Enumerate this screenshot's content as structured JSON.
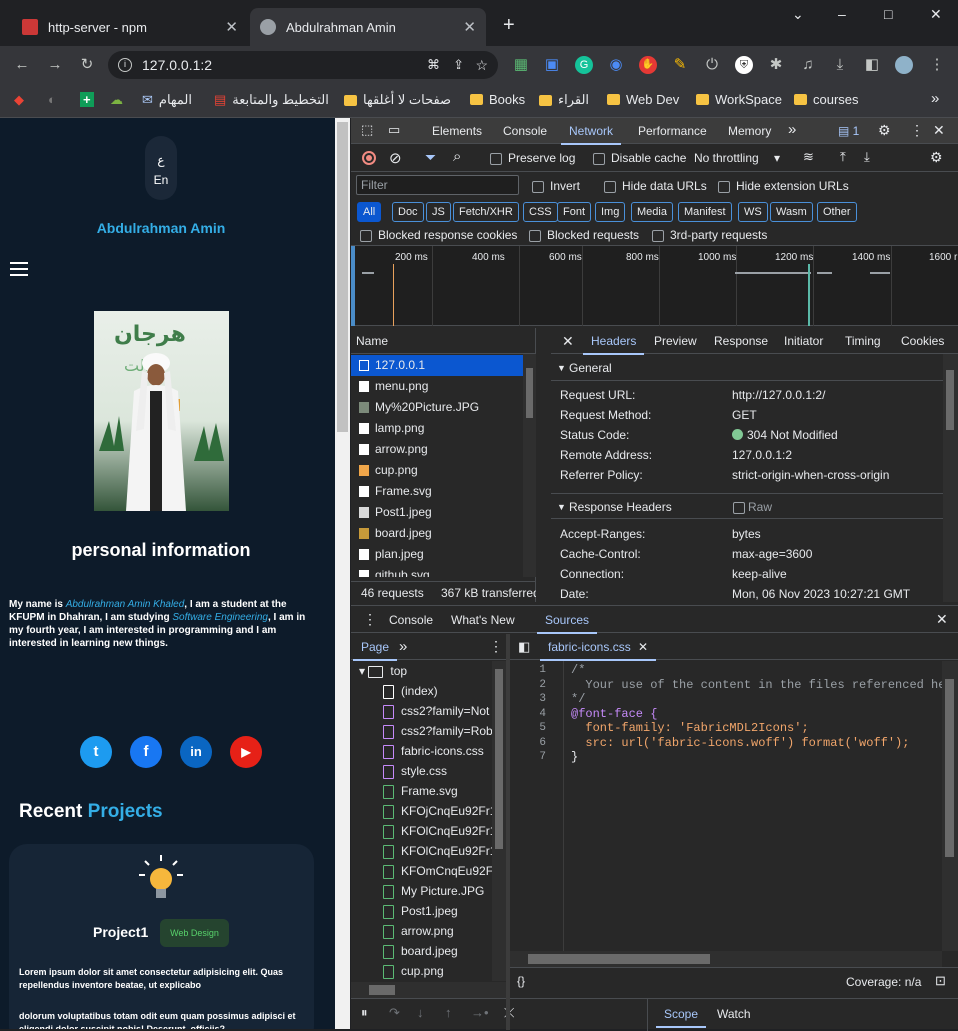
{
  "tabs": [
    {
      "title": "http-server - npm",
      "active": false
    },
    {
      "title": "Abdulrahman Amin",
      "active": true
    }
  ],
  "window": {
    "new_tab": "+",
    "minimize": "–",
    "maximize": "□",
    "close": "✕",
    "chevron": "⌄"
  },
  "omnibox": {
    "url": "127.0.0.1:2"
  },
  "bookmarks": [
    "المهام",
    "التخطيط والمتابعة",
    "صفحات لا أغلقها",
    "Books",
    "القراء",
    "Web Dev",
    "WorkSpace",
    "courses"
  ],
  "bookmarks_more": "»",
  "page": {
    "lang_ar": "ع",
    "lang_en": "En",
    "name": "Abdulrahman Amin",
    "personal_title": "personal information",
    "intro_pre": "My name is ",
    "intro_name": "Abdulrahman Amin Khaled",
    "intro_mid": ", I am a student at the KFUPM in Dhahran, I am studying ",
    "intro_major": "Software Engineering",
    "intro_post": ", I am in my fourth year, I am interested in programming and I am interested in learning new things.",
    "social": [
      "t",
      "f",
      "in",
      "▶"
    ],
    "recent": "Recent ",
    "projects": "Projects",
    "project_title": "Project1",
    "project_badge": "Web Design",
    "project_text1": "Lorem ipsum dolor sit amet consectetur adipisicing elit. Quas repellendus inventore beatae, ut explicabo",
    "project_text2": "dolorum voluptatibus totam odit eum quam possimus adipisci et eligendi dolor suscipit nobis! Deserunt, officiis?"
  },
  "devtools": {
    "tabs": [
      "Elements",
      "Console",
      "Network",
      "Performance",
      "Memory"
    ],
    "more": "»",
    "issues": "1",
    "network": {
      "preserve_log": "Preserve log",
      "disable_cache": "Disable cache",
      "throttling": "No throttling",
      "filter_placeholder": "Filter",
      "invert": "Invert",
      "hide_data": "Hide data URLs",
      "hide_ext": "Hide extension URLs",
      "types": [
        "All",
        "Doc",
        "JS",
        "Fetch/XHR",
        "CSS",
        "Font",
        "Img",
        "Media",
        "Manifest",
        "WS",
        "Wasm",
        "Other"
      ],
      "blocked_cookies": "Blocked response cookies",
      "blocked_requests": "Blocked requests",
      "third_party": "3rd-party requests",
      "ticks": [
        "200 ms",
        "400 ms",
        "600 ms",
        "800 ms",
        "1000 ms",
        "1200 ms",
        "1400 ms",
        "1600 r"
      ],
      "name_header": "Name",
      "requests": [
        "127.0.0.1",
        "menu.png",
        "My%20Picture.JPG",
        "lamp.png",
        "arrow.png",
        "cup.png",
        "Frame.svg",
        "Post1.jpeg",
        "board.jpeg",
        "plan.jpeg",
        "github.svg"
      ],
      "summary_requests": "46 requests",
      "summary_transferred": "367 kB transferred",
      "detail_tabs": [
        "Headers",
        "Preview",
        "Response",
        "Initiator",
        "Timing",
        "Cookies"
      ],
      "general": "General",
      "general_rows": [
        {
          "k": "Request URL:",
          "v": "http://127.0.0.1:2/"
        },
        {
          "k": "Request Method:",
          "v": "GET"
        },
        {
          "k": "Status Code:",
          "v": "304 Not Modified"
        },
        {
          "k": "Remote Address:",
          "v": "127.0.0.1:2"
        },
        {
          "k": "Referrer Policy:",
          "v": "strict-origin-when-cross-origin"
        }
      ],
      "response_headers": "Response Headers",
      "raw": "Raw",
      "response_rows": [
        {
          "k": "Accept-Ranges:",
          "v": "bytes"
        },
        {
          "k": "Cache-Control:",
          "v": "max-age=3600"
        },
        {
          "k": "Connection:",
          "v": "keep-alive"
        },
        {
          "k": "Date:",
          "v": "Mon, 06 Nov 2023 10:27:21 GMT"
        }
      ]
    },
    "drawer": {
      "tabs": [
        "Console",
        "What's New",
        "Sources"
      ],
      "page_tab": "Page",
      "file_tab": "fabric-icons.css",
      "tree": [
        "top",
        "(index)",
        "css2?family=Not",
        "css2?family=Rob",
        "fabric-icons.css",
        "style.css",
        "Frame.svg",
        "KFOjCnqEu92Fr1",
        "KFOlCnqEu92Fr1",
        "KFOlCnqEu92Fr1",
        "KFOmCnqEu92Fr",
        "My Picture.JPG",
        "Post1.jpeg",
        "arrow.png",
        "board.jpeg",
        "cup.png"
      ],
      "code": [
        "/*",
        "  Your use of the content in the files referenced here i",
        "*/",
        "@font-face {",
        "  font-family: 'FabricMDL2Icons';",
        "  src: url('fabric-icons.woff') format('woff');",
        "}"
      ],
      "coverage": "Coverage: n/a",
      "scope": "Scope",
      "watch": "Watch",
      "braces": "{}"
    }
  }
}
